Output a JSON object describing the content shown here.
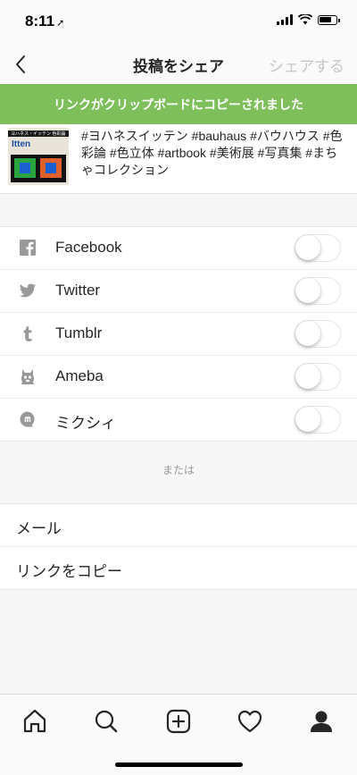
{
  "status_bar": {
    "time": "8:11",
    "location_arrow": "➚"
  },
  "nav": {
    "title": "投稿をシェア",
    "share_label": "シェアする"
  },
  "toast": {
    "message": "リンクがクリップボードにコピーされました"
  },
  "post": {
    "caption": "#ヨハネスイッテン #bauhaus  #バウハウス #色彩論 #色立体 #artbook #美術展 #写真集 #まちゃコレクション",
    "thumbnail": {
      "band_text": "ヨハネス・イッテン 色彩論",
      "title": "Itten"
    }
  },
  "social": [
    {
      "label": "Facebook",
      "icon": "facebook-icon",
      "enabled": false
    },
    {
      "label": "Twitter",
      "icon": "twitter-icon",
      "enabled": false
    },
    {
      "label": "Tumblr",
      "icon": "tumblr-icon",
      "enabled": false
    },
    {
      "label": "Ameba",
      "icon": "ameba-icon",
      "enabled": false
    },
    {
      "label": "ミクシィ",
      "icon": "mixi-icon",
      "enabled": false
    }
  ],
  "or_label": "または",
  "options": [
    {
      "label": "メール"
    },
    {
      "label": "リンクをコピー"
    }
  ],
  "tabs": [
    {
      "icon": "home-icon"
    },
    {
      "icon": "search-icon"
    },
    {
      "icon": "add-post-icon"
    },
    {
      "icon": "heart-icon"
    },
    {
      "icon": "profile-icon"
    }
  ],
  "colors": {
    "toast_bg": "#7ebf5c",
    "text": "#262626",
    "disabled_text": "#c7c7c7",
    "icon_gray": "#999999"
  }
}
